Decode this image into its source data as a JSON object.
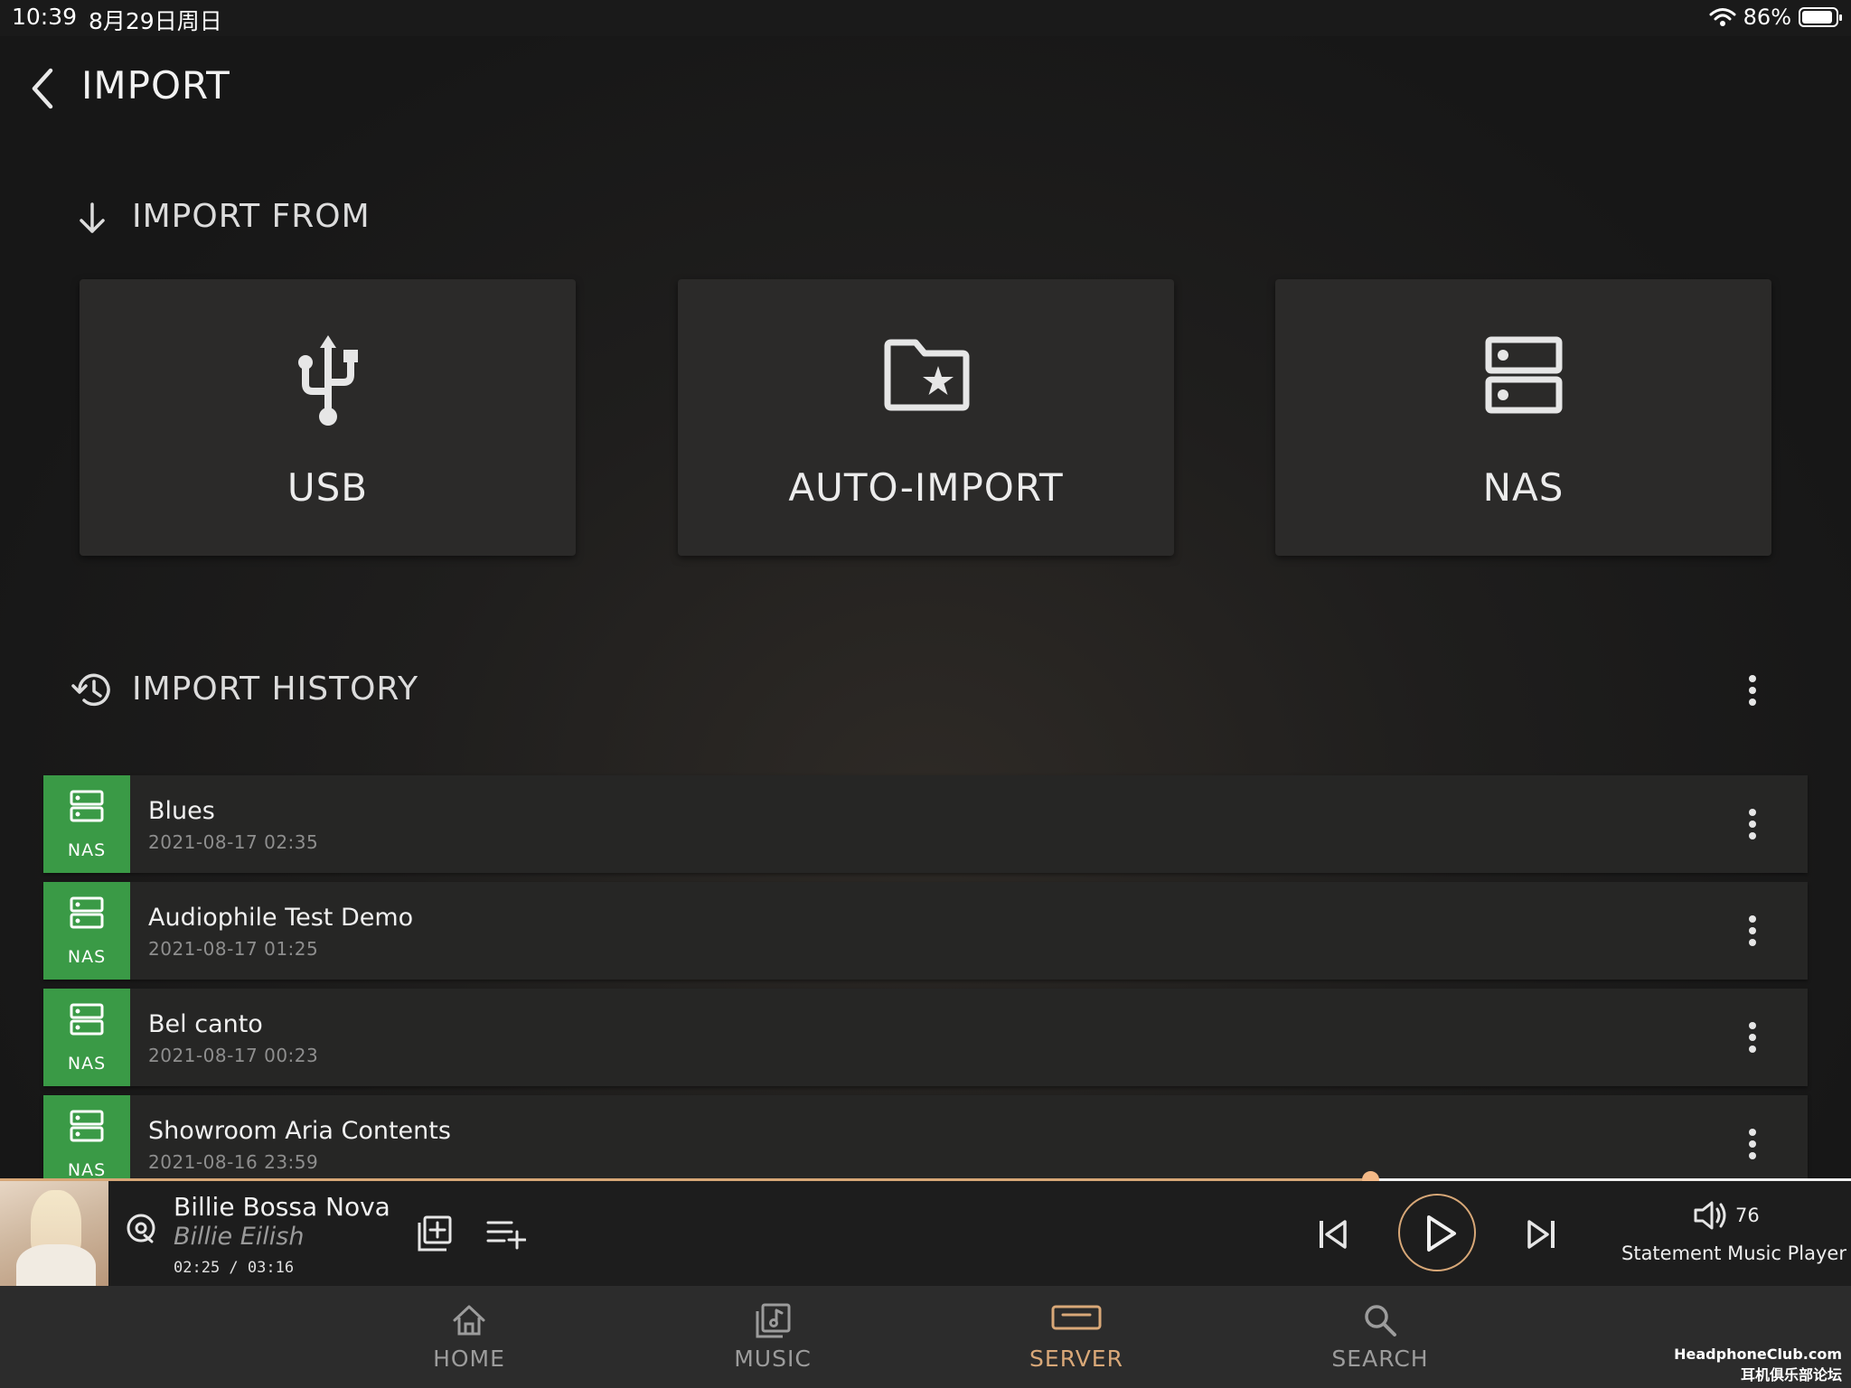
{
  "status_bar": {
    "time": "10:39",
    "date": "8月29日周日",
    "battery": "86%"
  },
  "header": {
    "title": "IMPORT"
  },
  "import_from": {
    "title": "IMPORT FROM",
    "tiles": [
      {
        "label": "USB",
        "icon": "usb-icon"
      },
      {
        "label": "AUTO-IMPORT",
        "icon": "folder-star-icon"
      },
      {
        "label": "NAS",
        "icon": "nas-icon"
      }
    ]
  },
  "import_history": {
    "title": "IMPORT HISTORY",
    "items": [
      {
        "source": "NAS",
        "title": "Blues",
        "date": "2021-08-17 02:35"
      },
      {
        "source": "NAS",
        "title": "Audiophile Test Demo",
        "date": "2021-08-17 01:25"
      },
      {
        "source": "NAS",
        "title": "Bel canto",
        "date": "2021-08-17 00:23"
      },
      {
        "source": "NAS",
        "title": "Showroom Aria Contents",
        "date": "2021-08-16 23:59"
      }
    ]
  },
  "player": {
    "song": "Billie Bossa Nova",
    "artist": "Billie Eilish",
    "timecode": "02:25 / 03:16",
    "progress_fraction": 0.74,
    "volume": "76",
    "device": "Statement Music Player",
    "accent_color": "#d7a777"
  },
  "bottom_nav": {
    "items": [
      {
        "label": "HOME",
        "icon": "home-icon"
      },
      {
        "label": "MUSIC",
        "icon": "music-library-icon"
      },
      {
        "label": "SERVER",
        "icon": "server-icon"
      },
      {
        "label": "SEARCH",
        "icon": "search-icon"
      }
    ],
    "active": "SERVER"
  },
  "watermark": {
    "line1": "HeadphoneClub.com",
    "line2": "耳机俱乐部论坛"
  }
}
